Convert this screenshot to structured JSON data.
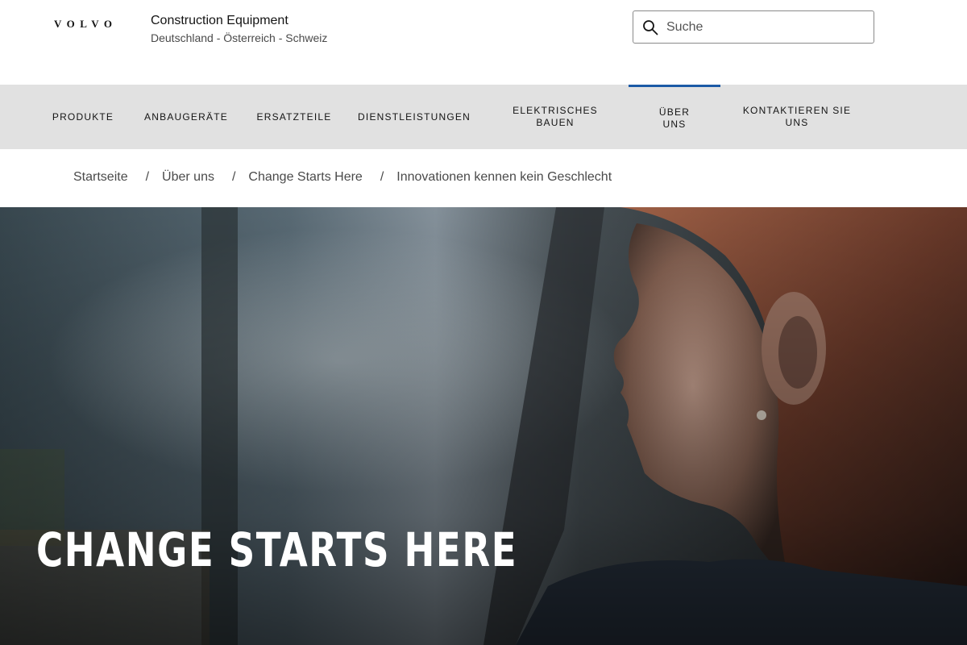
{
  "header": {
    "logo": "VOLVO",
    "brand_title": "Construction Equipment",
    "brand_subtitle": "Deutschland - Österreich - Schweiz",
    "search": {
      "placeholder": "Suche",
      "icon": "search-icon"
    }
  },
  "nav": {
    "active_color": "#1c5aa6",
    "items": [
      {
        "label": "PRODUKTE"
      },
      {
        "label": "ANBAUGERÄTE"
      },
      {
        "label": "ERSATZTEILE"
      },
      {
        "label": "DIENSTLEISTUNGEN"
      },
      {
        "label": "ELEKTRISCHES\nBAUEN"
      },
      {
        "label": "ÜBER\nUNS"
      },
      {
        "label": "KONTAKTIEREN SIE\nUNS"
      }
    ]
  },
  "breadcrumb": {
    "items": [
      {
        "label": "Startseite"
      },
      {
        "label": "Über uns"
      },
      {
        "label": "Change Starts Here"
      },
      {
        "label": "Innovationen kennen kein Geschlecht"
      }
    ],
    "separator": "/"
  },
  "hero": {
    "title": "CHANGE STARTS HERE"
  }
}
